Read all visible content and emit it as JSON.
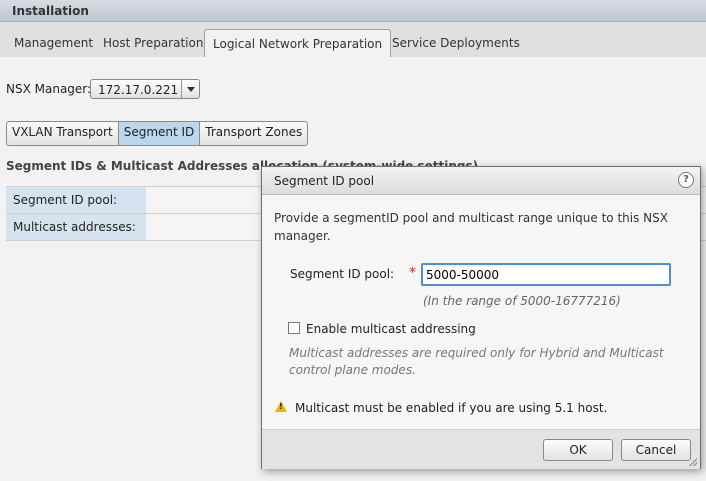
{
  "window": {
    "title": "Installation"
  },
  "tabs": [
    {
      "label": "Management",
      "active": false
    },
    {
      "label": "Host Preparation",
      "active": false
    },
    {
      "label": "Logical Network Preparation",
      "active": true
    },
    {
      "label": "Service Deployments",
      "active": false
    }
  ],
  "nsx_manager": {
    "label": "NSX Manager:",
    "value": "172.17.0.221"
  },
  "subtabs": [
    {
      "label": "VXLAN Transport",
      "active": false
    },
    {
      "label": "Segment ID",
      "active": true
    },
    {
      "label": "Transport Zones",
      "active": false
    }
  ],
  "section": {
    "title": "Segment IDs & Multicast Addresses allocation (system-wide settings)",
    "rows": [
      {
        "label": "Segment ID pool:"
      },
      {
        "label": "Multicast addresses:"
      }
    ]
  },
  "dialog": {
    "title": "Segment ID pool",
    "help_icon": "question-icon",
    "description": "Provide a segmentID pool and multicast range unique to this NSX manager.",
    "pool_label": "Segment ID pool:",
    "required_mark": "*",
    "pool_value": "5000-50000",
    "range_hint": "(In the range of 5000-16777216)",
    "multicast_label": "Enable multicast addressing",
    "multicast_checked": false,
    "multicast_hint": "Multicast addresses are required only for Hybrid and Multicast control plane modes.",
    "warning_icon": "warning-triangle-icon",
    "warning_color": "#f0b400",
    "warning": "Multicast must be enabled if you are using 5.1 host.",
    "ok_label": "OK",
    "cancel_label": "Cancel"
  }
}
